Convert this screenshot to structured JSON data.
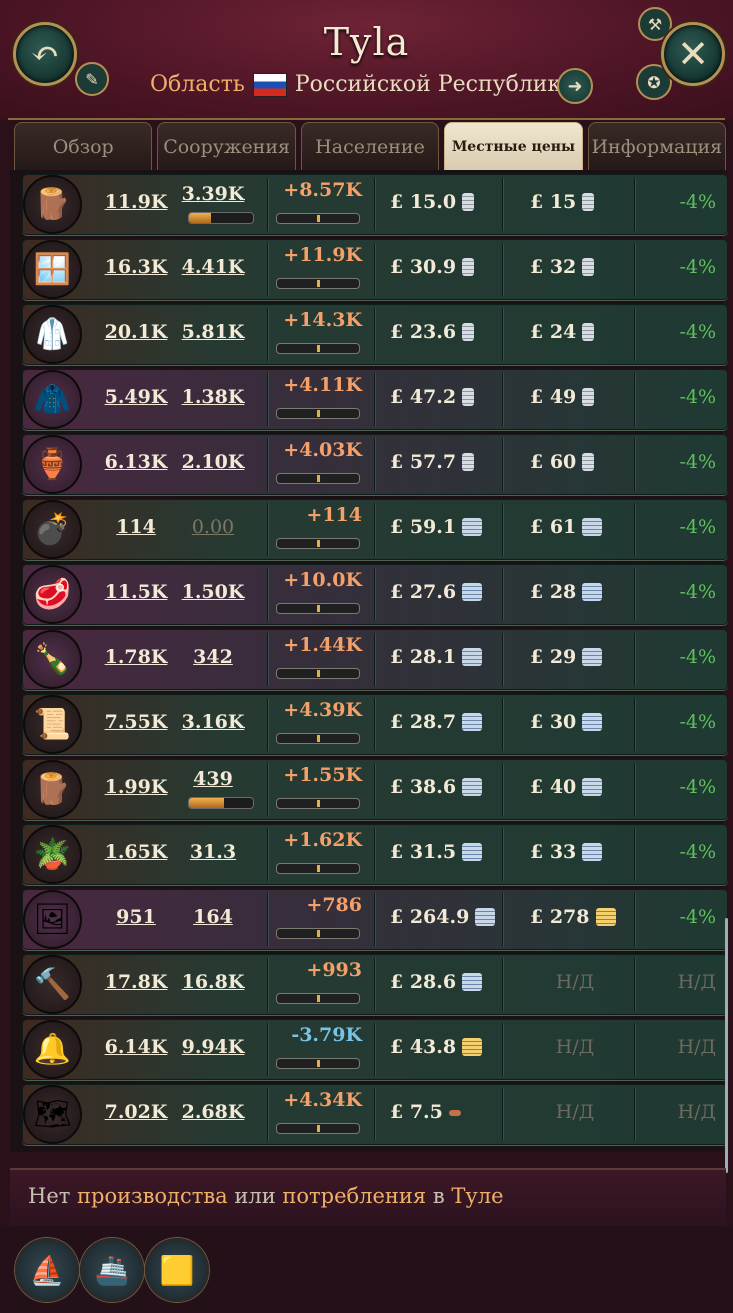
{
  "header": {
    "title": "Tyla",
    "subtitle_prefix": "Область",
    "subtitle_country": "Российской Республики",
    "back_icon": "undo-arrow-icon",
    "close_icon": "close-x-icon"
  },
  "tabs": [
    {
      "label": "Обзор",
      "active": false
    },
    {
      "label": "Сооружения",
      "active": false
    },
    {
      "label": "Население",
      "active": false
    },
    {
      "label": "Местные цены",
      "active": true
    },
    {
      "label": "Информация",
      "active": false
    }
  ],
  "rows": [
    {
      "icon": "wood-icon",
      "glyph": "🪵",
      "supply": "11.9K",
      "demand": "3.39K",
      "balance": "+8.57K",
      "price": "£ 15.0",
      "base": "£ 15",
      "pct": "-4%"
    },
    {
      "icon": "glass-icon",
      "glyph": "🪟",
      "supply": "16.3K",
      "demand": "4.41K",
      "balance": "+11.9K",
      "price": "£ 30.9",
      "base": "£ 32",
      "pct": "-4%"
    },
    {
      "icon": "clothes-icon",
      "glyph": "🥼",
      "supply": "20.1K",
      "demand": "5.81K",
      "balance": "+14.3K",
      "price": "£ 23.6",
      "base": "£ 24",
      "pct": "-4%"
    },
    {
      "icon": "luxury-clothes-icon",
      "glyph": "🧥",
      "supply": "5.49K",
      "demand": "1.38K",
      "balance": "+4.11K",
      "price": "£ 47.2",
      "base": "£ 49",
      "pct": "-4%"
    },
    {
      "icon": "porcelain-icon",
      "glyph": "🏺",
      "supply": "6.13K",
      "demand": "2.10K",
      "balance": "+4.03K",
      "price": "£ 57.7",
      "base": "£ 60",
      "pct": "-4%"
    },
    {
      "icon": "artillery-icon",
      "glyph": "💣",
      "supply": "114",
      "demand": "0.00",
      "balance": "+114",
      "price": "£ 59.1",
      "base": "£ 61",
      "pct": "-4%"
    },
    {
      "icon": "meat-icon",
      "glyph": "🥩",
      "supply": "11.5K",
      "demand": "1.50K",
      "balance": "+10.0K",
      "price": "£ 27.6",
      "base": "£ 28",
      "pct": "-4%"
    },
    {
      "icon": "liquor-icon",
      "glyph": "🍾",
      "supply": "1.78K",
      "demand": "342",
      "balance": "+1.44K",
      "price": "£ 28.1",
      "base": "£ 29",
      "pct": "-4%"
    },
    {
      "icon": "paper-icon",
      "glyph": "📜",
      "supply": "7.55K",
      "demand": "3.16K",
      "balance": "+4.39K",
      "price": "£ 28.7",
      "base": "£ 30",
      "pct": "-4%"
    },
    {
      "icon": "lumber-icon",
      "glyph": "🪵",
      "supply": "1.99K",
      "demand": "439",
      "balance": "+1.55K",
      "price": "£ 38.6",
      "base": "£ 40",
      "pct": "-4%"
    },
    {
      "icon": "fertilizer-icon",
      "glyph": "🪴",
      "supply": "1.65K",
      "demand": "31.3",
      "balance": "+1.62K",
      "price": "£ 31.5",
      "base": "£ 33",
      "pct": "-4%"
    },
    {
      "icon": "art-icon",
      "glyph": "🖼",
      "supply": "951",
      "demand": "164",
      "balance": "+786",
      "price": "£ 264.9",
      "base": "£ 278",
      "pct": "-4%"
    },
    {
      "icon": "tools-icon",
      "glyph": "🔨",
      "supply": "17.8K",
      "demand": "16.8K",
      "balance": "+993",
      "price": "£ 28.6",
      "base": "Н/Д",
      "pct": "Н/Д"
    },
    {
      "icon": "services-icon",
      "glyph": "🔔",
      "supply": "6.14K",
      "demand": "9.94K",
      "balance": "-3.79K",
      "price": "£ 43.8",
      "base": "Н/Д",
      "pct": "Н/Д"
    },
    {
      "icon": "map-icon",
      "glyph": "🗺",
      "supply": "7.02K",
      "demand": "2.68K",
      "balance": "+4.34K",
      "price": "£ 7.5",
      "base": "Н/Д",
      "pct": "Н/Д"
    }
  ],
  "footer": {
    "text_1": "Нет ",
    "link_1": "производства",
    "text_2": " или ",
    "link_2": "потребления",
    "text_3": " в ",
    "link_3": "Туле"
  },
  "bottom_buttons": [
    "sailing-ship-icon",
    "ironclad-ship-icon",
    "gold-bar-icon"
  ]
}
